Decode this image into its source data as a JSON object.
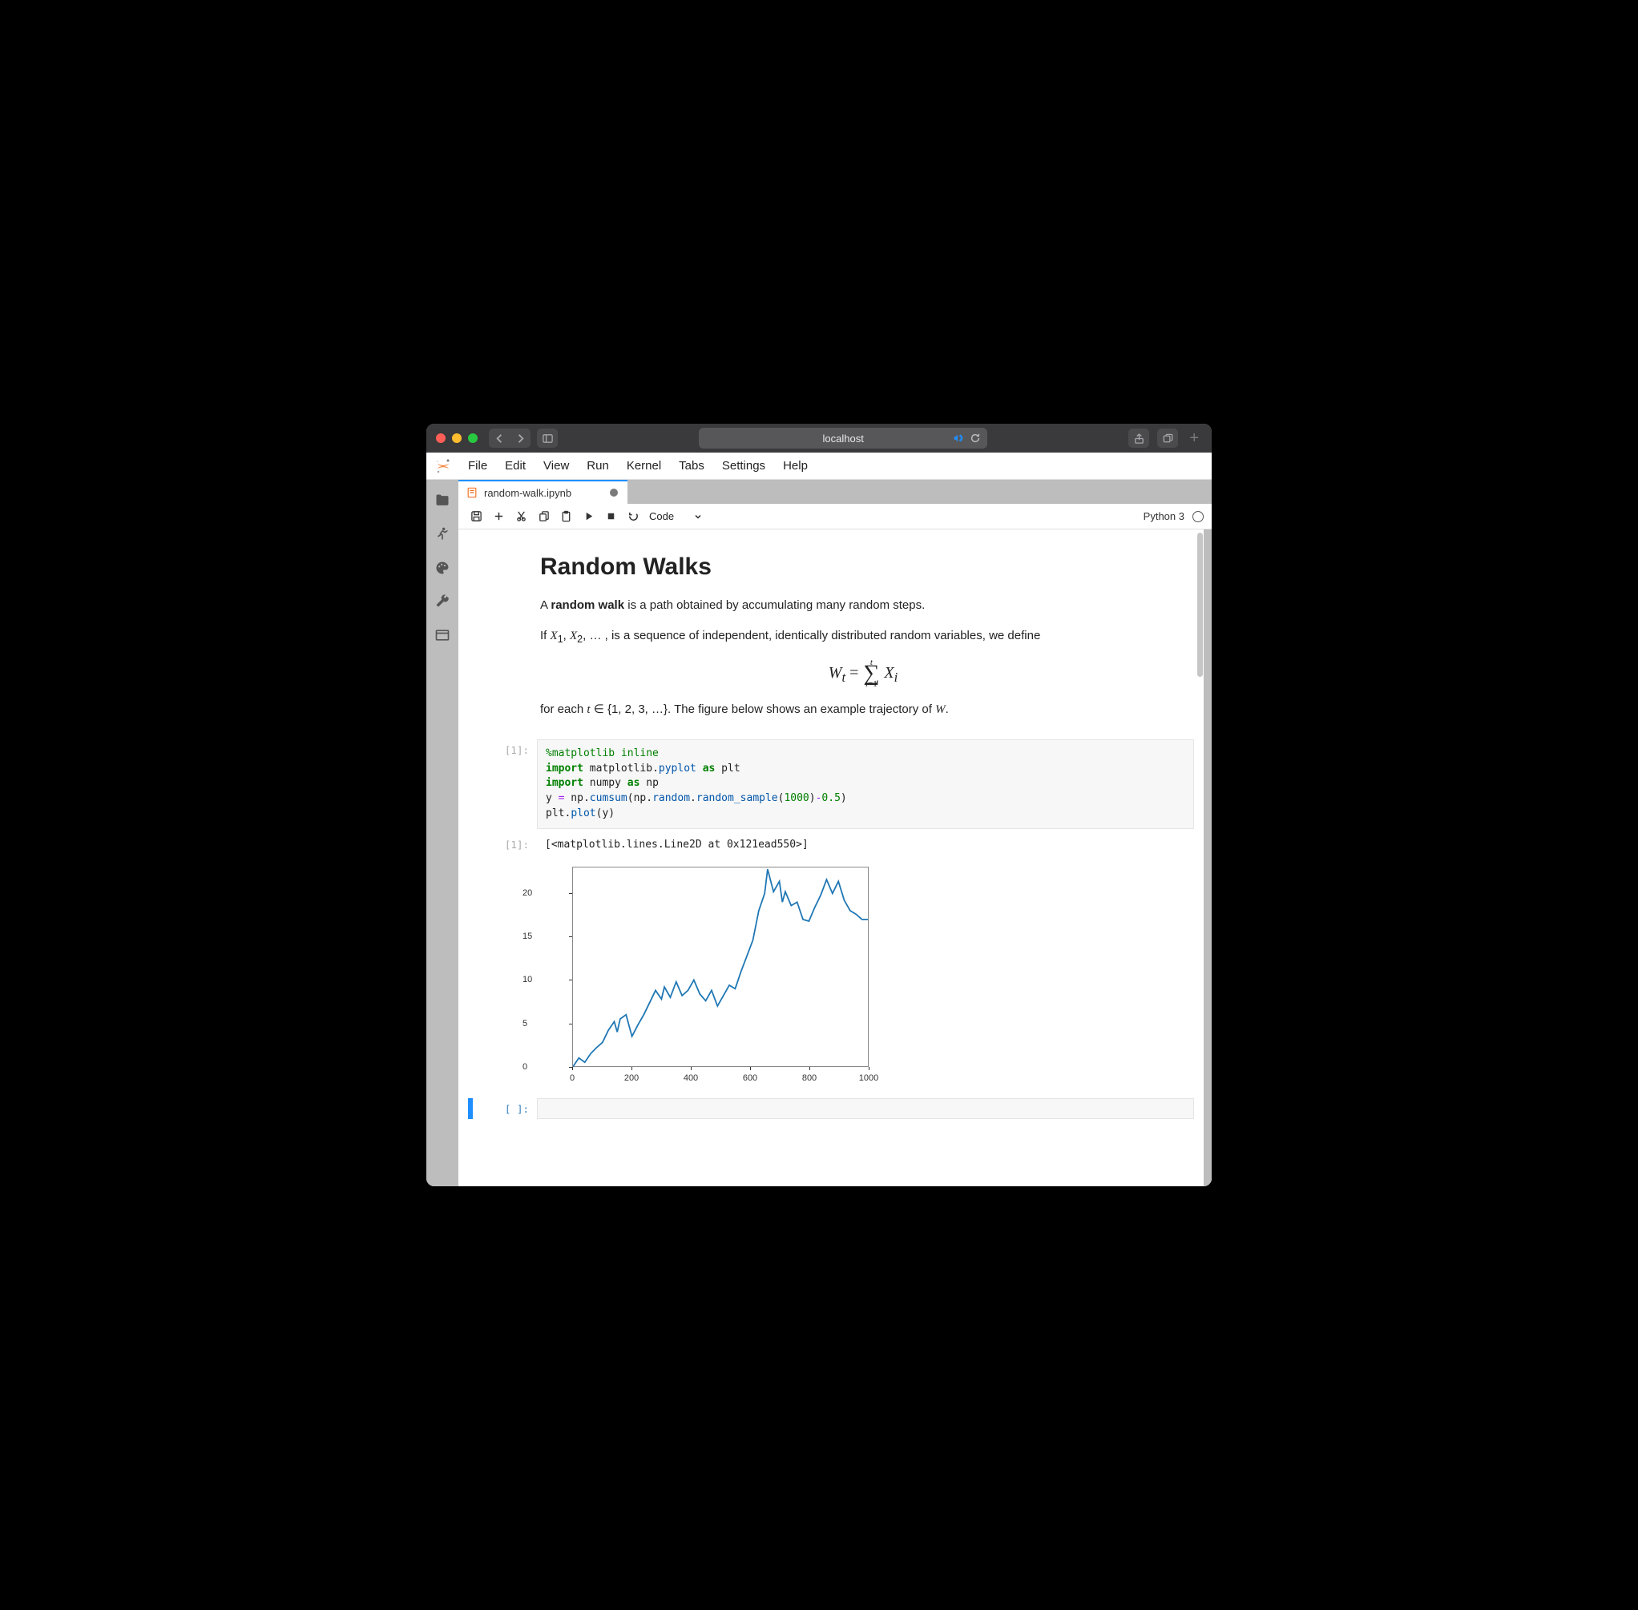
{
  "browser": {
    "address": "localhost"
  },
  "menus": [
    "File",
    "Edit",
    "View",
    "Run",
    "Kernel",
    "Tabs",
    "Settings",
    "Help"
  ],
  "tab": {
    "filename": "random-walk.ipynb"
  },
  "toolbar": {
    "celltype": "Code"
  },
  "kernel": {
    "name": "Python 3"
  },
  "markdown": {
    "title": "Random Walks",
    "p1_a": "A ",
    "p1_b": "random walk",
    "p1_c": " is a path obtained by accumulating many random steps.",
    "p2_a": "If ",
    "p2_b": " is a sequence of independent, identically distributed random variables, we define",
    "p3_a": "for each ",
    "p3_b": ". The figure below shows an example trajectory of "
  },
  "code_cell": {
    "prompt": "[1]:",
    "l1_magic": "%matplotlib inline",
    "l2_import": "import",
    "l2_mod": "matplotlib.",
    "l2_pyplot": "pyplot",
    "l2_as": "as",
    "l2_alias": "plt",
    "l3_import": "import",
    "l3_mod": "numpy",
    "l3_as": "as",
    "l3_alias": "np",
    "l4_a": "y ",
    "l4_eq": "=",
    "l4_b": " np.",
    "l4_cumsum": "cumsum",
    "l4_c": "(np.",
    "l4_random": "random",
    "l4_d": ".",
    "l4_randsamp": "random_sample",
    "l4_e": "(",
    "l4_num1": "1000",
    "l4_f": ")",
    "l4_minus": "-",
    "l4_num2": "0.5",
    "l4_g": ")",
    "l5_a": "plt.",
    "l5_plot": "plot",
    "l5_b": "(y)"
  },
  "output": {
    "prompt": "[1]:",
    "text": "[<matplotlib.lines.Line2D at 0x121ead550>]"
  },
  "empty_cell": {
    "prompt": "[ ]:"
  },
  "chart_data": {
    "type": "line",
    "xlabel": "",
    "ylabel": "",
    "xlim": [
      0,
      1000
    ],
    "ylim": [
      0,
      23
    ],
    "xticks": [
      0,
      200,
      400,
      600,
      800,
      1000
    ],
    "yticks": [
      0,
      5,
      10,
      15,
      20
    ],
    "series": [
      {
        "name": "y",
        "x": [
          0,
          20,
          40,
          60,
          80,
          100,
          120,
          140,
          150,
          160,
          180,
          200,
          220,
          240,
          260,
          280,
          300,
          310,
          330,
          350,
          370,
          390,
          410,
          430,
          450,
          470,
          490,
          510,
          530,
          550,
          570,
          590,
          610,
          630,
          650,
          660,
          680,
          700,
          710,
          720,
          740,
          760,
          780,
          800,
          820,
          840,
          860,
          880,
          900,
          920,
          940,
          960,
          980,
          1000
        ],
        "values": [
          0,
          1,
          0.5,
          1.5,
          2.2,
          2.8,
          4.2,
          5.2,
          4.0,
          5.5,
          6.0,
          3.5,
          4.8,
          6.0,
          7.4,
          8.8,
          7.8,
          9.2,
          8.0,
          9.8,
          8.2,
          8.8,
          10.0,
          8.4,
          7.6,
          8.8,
          7.0,
          8.2,
          9.4,
          9.0,
          11.0,
          12.8,
          14.6,
          18.0,
          20.0,
          22.8,
          20.2,
          21.4,
          19.0,
          20.2,
          18.6,
          19.0,
          17.0,
          16.8,
          18.4,
          19.8,
          21.6,
          20.0,
          21.4,
          19.2,
          18.0,
          17.6,
          17.0,
          17.0
        ]
      }
    ]
  }
}
